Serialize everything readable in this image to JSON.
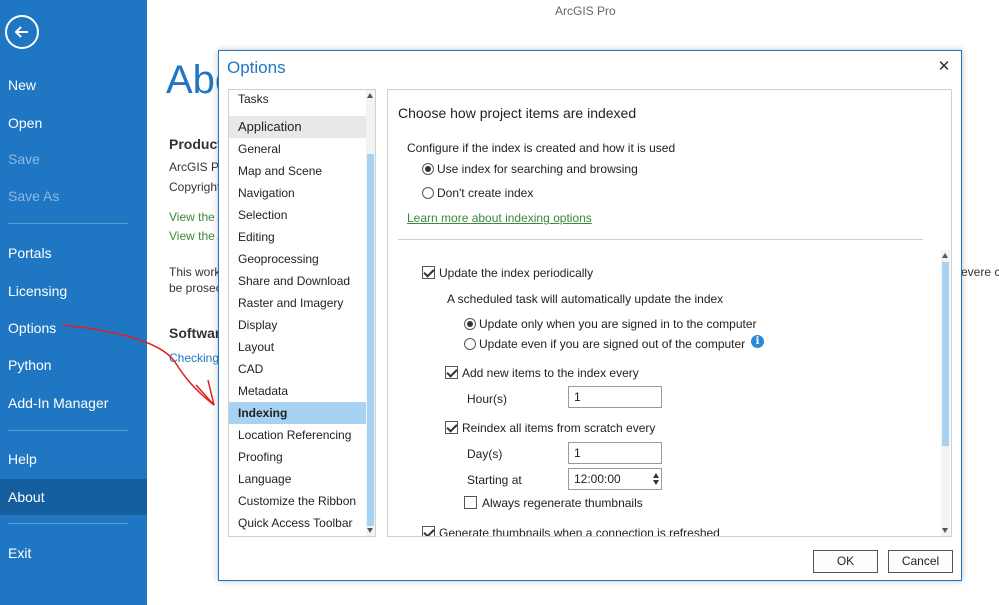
{
  "app_title": "ArcGIS Pro",
  "backstage": {
    "items": [
      {
        "label": "New"
      },
      {
        "label": "Open"
      },
      {
        "label": "Save"
      },
      {
        "label": "Save As"
      },
      {
        "label": "Portals"
      },
      {
        "label": "Licensing"
      },
      {
        "label": "Options"
      },
      {
        "label": "Python"
      },
      {
        "label": "Add-In Manager"
      },
      {
        "label": "Help"
      },
      {
        "label": "About"
      },
      {
        "label": "Exit"
      }
    ]
  },
  "background": {
    "heading": "Abo",
    "product": "Product",
    "line1": "ArcGIS Pro",
    "line2": "Copyright",
    "link1": "View the A",
    "link2": "View the A",
    "warn1": "This work",
    "warn2": "be prosec",
    "right_text": "evere ci",
    "software": "Software",
    "checking": "Checking"
  },
  "dialog": {
    "title": "Options",
    "close": "✕",
    "nav": {
      "items": [
        "Tasks",
        "Application",
        "General",
        "Map and Scene",
        "Navigation",
        "Selection",
        "Editing",
        "Geoprocessing",
        "Share and Download",
        "Raster and Imagery",
        "Display",
        "Layout",
        "CAD",
        "Metadata",
        "Indexing",
        "Location Referencing",
        "Proofing",
        "Language",
        "Customize the Ribbon",
        "Quick Access Toolbar"
      ],
      "selected": "Indexing"
    },
    "content": {
      "title": "Choose how project items are indexed",
      "config_label": "Configure if the index is created and how it is used",
      "radio_use_index": "Use index for searching and browsing",
      "radio_dont_create": "Don't create index",
      "learn_more": "Learn more about indexing options",
      "update_periodically": "Update the index periodically",
      "scheduled_task": "A scheduled task will automatically update the index",
      "radio_signed_in": "Update only when you are signed in to the computer",
      "radio_signed_out": "Update even if you are signed out of the computer",
      "add_new_items": "Add new items to the index every",
      "hours_label": "Hour(s)",
      "hours_value": "1",
      "reindex": "Reindex all items from scratch every",
      "days_label": "Day(s)",
      "days_value": "1",
      "starting_label": "Starting at",
      "starting_value": "12:00:00",
      "regenerate": "Always regenerate thumbnails",
      "generate_thumbnails": "Generate thumbnails when a connection is refreshed"
    },
    "ok": "OK",
    "cancel": "Cancel"
  }
}
